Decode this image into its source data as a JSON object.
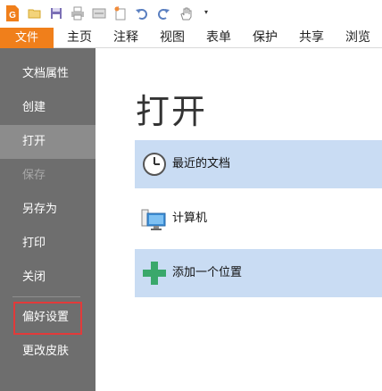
{
  "quick_access": {
    "icons": [
      "app-logo-icon",
      "open-folder-icon",
      "save-icon",
      "print-icon",
      "scan-icon",
      "new-icon",
      "undo-icon",
      "redo-icon",
      "hand-tool-icon",
      "dropdown-arrow-icon"
    ],
    "dropdown_glyph": "▾"
  },
  "tabs": {
    "file": "文件",
    "items": [
      "主页",
      "注释",
      "视图",
      "表单",
      "保护",
      "共享",
      "浏览"
    ]
  },
  "sidebar": {
    "items": [
      {
        "label": "文档属性"
      },
      {
        "label": "创建"
      },
      {
        "label": "打开"
      },
      {
        "label": "保存"
      },
      {
        "label": "另存为"
      },
      {
        "label": "打印"
      },
      {
        "label": "关闭"
      },
      {
        "label": "偏好设置"
      },
      {
        "label": "更改皮肤"
      }
    ]
  },
  "main": {
    "title": "打开",
    "options": [
      {
        "label": "最近的文档",
        "icon": "clock-icon"
      },
      {
        "label": "计算机",
        "icon": "computer-icon"
      },
      {
        "label": "添加一个位置",
        "icon": "plus-icon"
      }
    ]
  },
  "colors": {
    "file_tab": "#f07f1b",
    "sidebar_bg": "#6e6e6e",
    "selected_option": "#c9dcf3",
    "highlight_border": "#e23a3a",
    "plus_icon": "#3aa86b"
  }
}
